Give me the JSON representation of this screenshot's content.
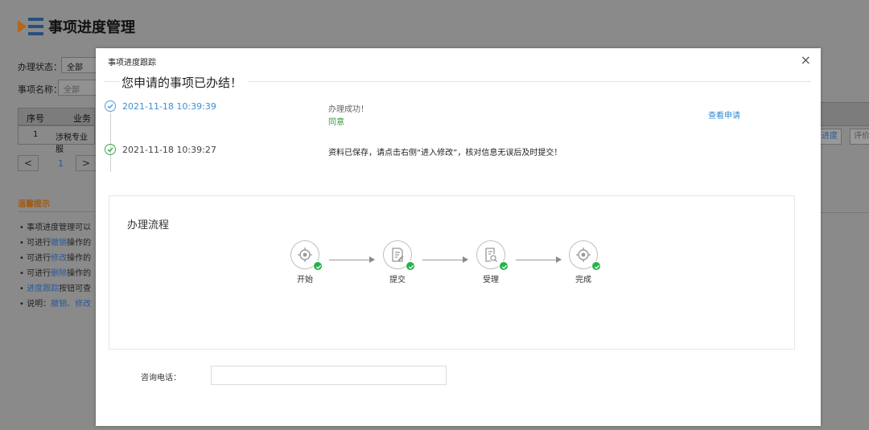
{
  "background": {
    "page_title": "事项进度管理",
    "status_label": "办理状态：",
    "status_value": "全部",
    "name_label": "事项名称：",
    "name_placeholder": "全部",
    "table_headers": [
      "序号",
      "业务"
    ],
    "table_row": {
      "index": "1",
      "name": "涉税专业服"
    },
    "pager": {
      "prev": "<",
      "page": "1",
      "next": ">"
    },
    "right_buttons": [
      "进度",
      "评价"
    ],
    "hint_title": "温馨提示",
    "hints": [
      {
        "prefix": "事项进度管理可以",
        "link": "",
        "suffix": ""
      },
      {
        "prefix": "可进行",
        "link": "撤销",
        "suffix": "操作的"
      },
      {
        "prefix": "可进行",
        "link": "修改",
        "suffix": "操作的"
      },
      {
        "prefix": "可进行",
        "link": "删除",
        "suffix": "操作的"
      },
      {
        "prefix": "",
        "link": "进度跟踪",
        "suffix": "按钮可查"
      },
      {
        "prefix": "说明：",
        "link": "撤销、修改",
        "suffix": ""
      }
    ]
  },
  "modal": {
    "title": "事项进度跟踪",
    "close": "×",
    "heading": "您申请的事项已办结！",
    "timeline": [
      {
        "time": "2021-11-18 10:39:39",
        "message": "办理成功！",
        "sub": "同意",
        "link": "查看申请"
      },
      {
        "time": "2021-11-18 10:39:27",
        "message": "资料已保存，请点击右侧“进入修改”，核对信息无误后及时提交！"
      }
    ],
    "flow_title": "办理流程",
    "flow_steps": [
      {
        "label": "开始",
        "icon": "target-icon"
      },
      {
        "label": "提交",
        "icon": "document-edit-icon"
      },
      {
        "label": "受理",
        "icon": "document-search-icon"
      },
      {
        "label": "完成",
        "icon": "target-icon"
      }
    ],
    "phone_label": "咨询电话：",
    "phone_value": ""
  }
}
